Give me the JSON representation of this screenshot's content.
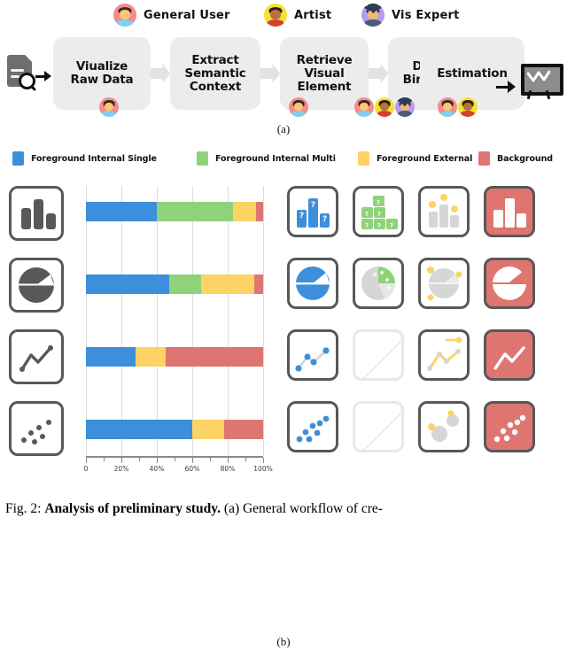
{
  "figure": {
    "caption_prefix": "Fig. 2:",
    "caption_bold": "Analysis of preliminary study.",
    "caption_rest": "(a) General workflow of cre-",
    "label_a": "(a)",
    "label_b": "(b)"
  },
  "panel_a": {
    "personas": [
      {
        "id": "general-user",
        "label": "General User",
        "color": "#f58b8b"
      },
      {
        "id": "artist",
        "label": "Artist",
        "color": "#f2e235"
      },
      {
        "id": "vis-expert",
        "label": "Vis Expert",
        "color": "#b99af0"
      }
    ],
    "source_icon": "document-search-icon",
    "output_icon": "presentation-board-icon",
    "steps": [
      {
        "label": "Viualize\nRaw Data",
        "avatars": [
          "general-user"
        ]
      },
      {
        "label": "Extract\nSemantic\nContext",
        "avatars": []
      },
      {
        "label": "Retrieve\nVisual\nElement",
        "avatars": [
          "general-user"
        ]
      },
      {
        "label": "Data\nBinding",
        "avatars": [
          "general-user",
          "artist",
          "vis-expert"
        ]
      },
      {
        "label": "Estimation",
        "avatars": [
          "general-user",
          "artist"
        ]
      }
    ]
  },
  "panel_b": {
    "categories_legend": [
      {
        "label": "Foreground Internal Single",
        "color": "#3d8fdb"
      },
      {
        "label": "Foreground Internal Multi",
        "color": "#8ed27a"
      },
      {
        "label": "Foreground External",
        "color": "#fcd364"
      },
      {
        "label": "Background",
        "color": "#df7570"
      }
    ],
    "row_icons": [
      "bar-chart-icon",
      "pie-chart-icon",
      "line-chart-icon",
      "scatter-plot-icon"
    ],
    "thumbnail_grid": [
      [
        "bar-internal-single",
        "bar-internal-multi",
        "bar-external",
        "bar-background"
      ],
      [
        "pie-internal-single",
        "pie-internal-multi",
        "pie-external",
        "pie-background"
      ],
      [
        "line-internal-single",
        "line-internal-multi-empty",
        "line-external",
        "line-background"
      ],
      [
        "scatter-internal-single",
        "scatter-internal-multi-empty",
        "scatter-external",
        "scatter-background"
      ]
    ]
  },
  "chart_data": {
    "type": "bar",
    "orientation": "horizontal",
    "stacked": true,
    "normalized": true,
    "title": "",
    "xlabel": "",
    "ylabel": "",
    "xlim": [
      0,
      100
    ],
    "grid": true,
    "legend_position": "top",
    "categories": [
      "Bar Chart",
      "Pie Chart",
      "Line Chart",
      "Scatter Plot"
    ],
    "xticks": [
      0,
      20,
      40,
      60,
      80,
      100
    ],
    "xtick_labels": [
      "0",
      "20%",
      "40%",
      "60%",
      "80%",
      "100%"
    ],
    "minor_ticks": [
      10,
      30,
      50,
      70,
      90
    ],
    "series": [
      {
        "name": "Foreground Internal Single",
        "color": "#3d8fdb",
        "values": [
          40,
          47,
          28,
          60
        ]
      },
      {
        "name": "Foreground Internal Multi",
        "color": "#8ed27a",
        "values": [
          43,
          18,
          0,
          0
        ]
      },
      {
        "name": "Foreground External",
        "color": "#fcd364",
        "values": [
          13,
          30,
          17,
          18
        ]
      },
      {
        "name": "Background",
        "color": "#df7570",
        "values": [
          4,
          5,
          55,
          22
        ]
      }
    ]
  }
}
